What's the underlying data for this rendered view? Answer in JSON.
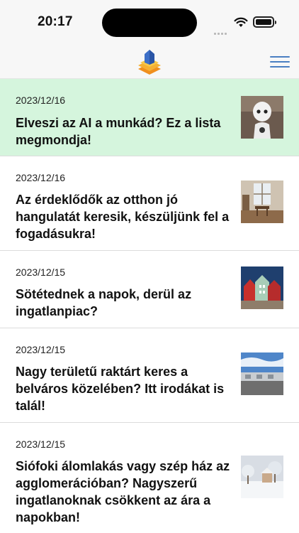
{
  "status_bar": {
    "time": "20:17"
  },
  "header": {
    "logo": "house-stack-logo",
    "menu_icon": "hamburger-menu-icon"
  },
  "articles": [
    {
      "date": "2023/12/16",
      "title": "Elveszi az AI a munkád? Ez a lista megmondja!",
      "thumbnail": "robot-image",
      "highlighted": true
    },
    {
      "date": "2023/12/16",
      "title": "Az érdeklődők az otthon jó hangulatát keresik, készüljünk fel a fogadásukra!",
      "thumbnail": "interior-room-image",
      "highlighted": false
    },
    {
      "date": "2023/12/15",
      "title": "Sötétednek a napok, derül az ingatlanpiac?",
      "thumbnail": "colorful-houses-image",
      "highlighted": false
    },
    {
      "date": "2023/12/15",
      "title": "Nagy területű raktárt keres a belváros közelében? Itt irodákat is talál!",
      "thumbnail": "warehouse-image",
      "highlighted": false
    },
    {
      "date": "2023/12/15",
      "title": "Siófoki álomlakás vagy szép ház az agglomerációban? Nagyszerű ingatlanoknak csökkent az ára a napokban!",
      "thumbnail": "snowy-garden-image",
      "highlighted": false
    }
  ],
  "colors": {
    "highlight_bg": "#d5f5dd",
    "menu_accent": "#4a7fc2",
    "logo_blue": "#3d6fc7",
    "logo_orange": "#f3a42a"
  }
}
